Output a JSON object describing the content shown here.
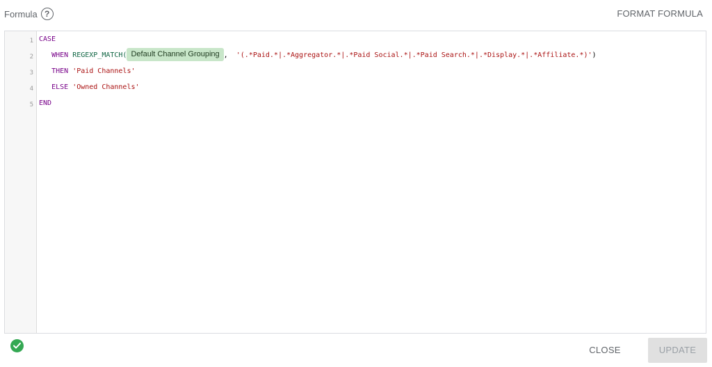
{
  "header": {
    "title": "Formula",
    "help_icon": "?",
    "format_label": "FORMAT FORMULA"
  },
  "editor": {
    "line_numbers": [
      "1",
      "2",
      "3",
      "4",
      "5"
    ],
    "line1": {
      "keyword": "CASE"
    },
    "line2": {
      "keyword": "WHEN",
      "function": "REGEXP_MATCH(",
      "field_chip": "Default Channel Grouping",
      "separator": ",",
      "pattern": "'(.*Paid.*|.*Aggregator.*|.*Paid Social.*|.*Paid Search.*|.*Display.*|.*Affiliate.*)'",
      "close_paren": ")"
    },
    "line3": {
      "keyword": "THEN",
      "value": "'Paid Channels'"
    },
    "line4": {
      "keyword": "ELSE",
      "value": "'Owned Channels'"
    },
    "line5": {
      "keyword": "END"
    }
  },
  "footer": {
    "status_icon": "check-circle-icon",
    "status_color": "#34a853",
    "close_label": "CLOSE",
    "update_label": "UPDATE"
  }
}
